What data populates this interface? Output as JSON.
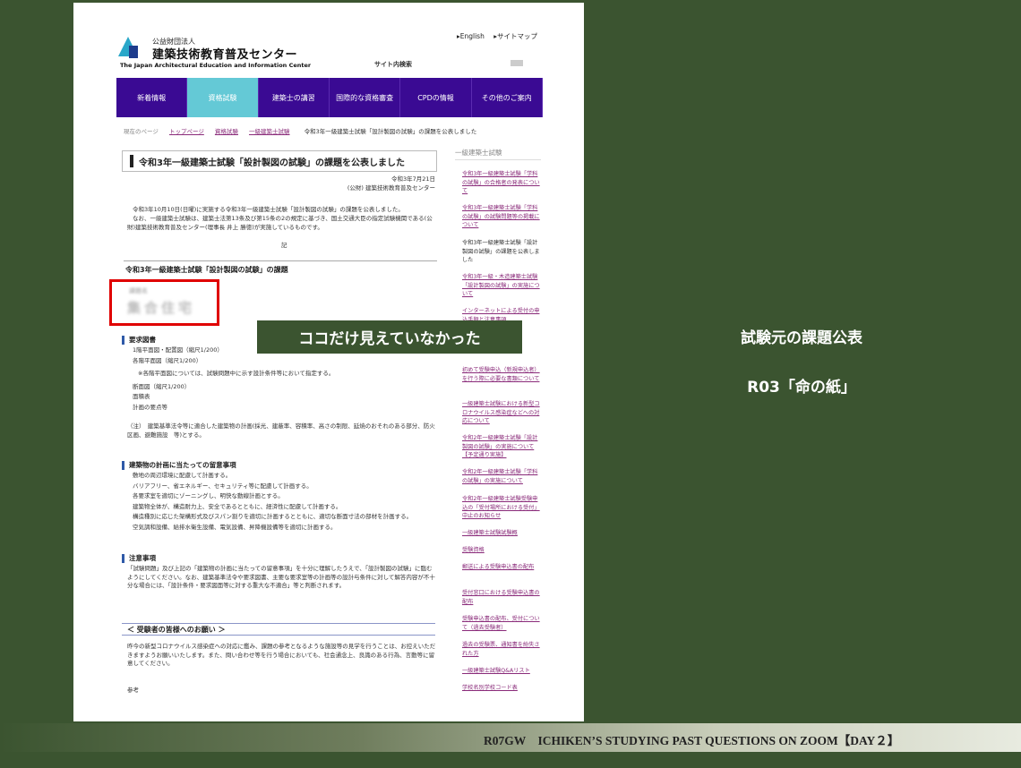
{
  "header": {
    "org_small": "公益財団法人",
    "org_name": "建築技術教育普及センター",
    "org_en": "The Japan Architectural Education and Information Center",
    "link_english": "▸English",
    "link_sitemap": "▸サイトマップ",
    "site_search": "サイト内検索"
  },
  "nav": [
    "新着情報",
    "資格試験",
    "建築士の講習",
    "国際的な資格審査",
    "CPDの情報",
    "その他のご案内"
  ],
  "breadcrumb": {
    "prefix": "現在のページ",
    "items": [
      "トップページ",
      "資格試験",
      "一級建築士試験"
    ],
    "current": "令和3年一級建築士試験「設計製図の試験」の課題を公表しました"
  },
  "article": {
    "title": "令和3年一級建築士試験「設計製図の試験」の課題を公表しました",
    "date": "令和3年7月21日",
    "publisher": "(公財) 建築技術教育普及センター",
    "intro_1": "令和3年10月10日(日曜)に実施する令和3年一級建築士試験「設計製図の試験」の課題を公表しました。",
    "intro_2": "なお、一級建築士試験は、建築士法第13条及び第15条の2の規定に基づき、国土交通大臣の指定試験機関である(公財)建築技術教育普及センター(理事長 井上 勝徳)が実施しているものです。",
    "ki": "記",
    "subhead": "令和3年一級建築士試験「設計製図の試験」の課題",
    "blurred_label": "課題名",
    "blurred_title": "集合住宅",
    "req_head": "要求図書",
    "req_items": [
      "1階平面図・配置図（縮尺1/200）",
      "各階平面図（縮尺1/200）",
      "※各階平面図については、試験問題中に示す設計条件等において指定する。",
      "断面図（縮尺1/200）",
      "面積表",
      "計画の要点等"
    ],
    "req_note": "（注）　建築基準法令等に適合した建築物の計画(採光、建蔽率、容積率、高さの制限、延焼のおそれのある部分、防火区画、避難施設　等)とする。",
    "plan_head": "建築物の計画に当たっての留意事項",
    "plan_items": [
      "敷地の周辺環境に配慮して計画する。",
      "バリアフリー、省エネルギー、セキュリティ等に配慮して計画する。",
      "各要求室を適切にゾーニングし、明快な動線計画とする。",
      "建築物全体が、構造耐力上、安全であるとともに、経済性に配慮して計画する。",
      "構造種別に応じた架構形式及びスパン割りを適切に計画するとともに、適切な断面寸法の部材を計画する。",
      "空気調和設備、給排水衛生設備、電気設備、昇降機設備等を適切に計画する。"
    ],
    "caution_head": "注意事項",
    "caution_text": "「試験問題」及び上記の「建築物の計画に当たっての留意事項」を十分に理解したうえで、「設計製図の試験」に臨むようにしてください。なお、建築基準法令や要求図書、主要な要求室等の計画等の設計与条件に対して解答内容が不十分な場合には、「設計条件・要求図面等に対する重大な不適合」等と判断されます。",
    "plea_title": "＜ 受験者の皆様へのお願い ＞",
    "plea_text": "昨今の新型コロナウイルス感染症への対応に鑑み、課題の参考となるような施設等の見学を行うことは、お控えいただきますようお願いいたします。また、問い合わせ等を行う場合においても、社会通念上、良識のある行為、言動等に留意してください。",
    "ref": "参考"
  },
  "sidebar": {
    "heading": "一級建築士試験",
    "items": [
      "令和3年一級建築士試験「学科の試験」の合格者の発表について",
      "令和3年一級建築士試験「学科の試験」の試験問題等の掲載について",
      "令和3年一級建築士試験「設計製図の試験」の課題を公表しました",
      "令和3年一級・木造建築士試験「設計製図の試験」の実施について",
      "インターネットによる受付の申込手順と注意事項",
      "初めて受験申込（新規申込者）を行う際に必要な書類について",
      "一級建築士試験における新型コロナウイルス感染症などへの対応について",
      "令和2年一級建築士試験「設計製図の試験」の実施について【予定通り実施】",
      "令和2年一級建築士試験「学科の試験」の実施について",
      "令和2年一級建築士試験受験申込の「受付場所における受付」中止のお知らせ",
      "一級建築士試験試験概",
      "受験資格",
      "郵送による受験申込書の配布",
      "受付窓口における受験申込書の配布",
      "受験申込書の配布、受付について（過去受験者）",
      "過去の受験票、通知書を紛失された方",
      "一級建築士試験Q&Aリスト",
      "学校名別学校コード表"
    ]
  },
  "overlay": {
    "callout": "ココだけ見えていなかった",
    "right_title": "試験元の課題公表",
    "right_subtitle": "R03「命の紙」",
    "footer": "R07GW　ICHIKEN’S STUDYING PAST QUESTIONS ON ZOOM【DAY２】"
  },
  "colors": {
    "background": "#3b5430",
    "nav": "#3a0a93",
    "nav_active": "#64c9d6",
    "highlight_box": "#e00000",
    "link": "#8a2b7a"
  }
}
